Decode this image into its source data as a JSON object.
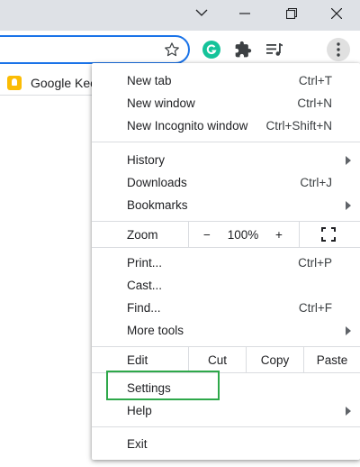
{
  "titlebar": {
    "minimize_glyph": "⌵",
    "restore_glyph": "❐",
    "close_glyph": "✕"
  },
  "toolbar": {
    "star_glyph": "☆",
    "grammarly_glyph": "G",
    "extensions_glyph": "✦",
    "media_glyph": "≡♪",
    "menu_glyph": "⋮"
  },
  "bookmarks": {
    "items": [
      {
        "label": "Google Kee"
      }
    ]
  },
  "menu": {
    "new_tab": {
      "label": "New tab",
      "shortcut": "Ctrl+T"
    },
    "new_window": {
      "label": "New window",
      "shortcut": "Ctrl+N"
    },
    "new_incognito": {
      "label": "New Incognito window",
      "shortcut": "Ctrl+Shift+N"
    },
    "history": {
      "label": "History"
    },
    "downloads": {
      "label": "Downloads",
      "shortcut": "Ctrl+J"
    },
    "bookmarks": {
      "label": "Bookmarks"
    },
    "zoom": {
      "label": "Zoom",
      "minus": "−",
      "level": "100%",
      "plus": "+"
    },
    "print": {
      "label": "Print...",
      "shortcut": "Ctrl+P"
    },
    "cast": {
      "label": "Cast..."
    },
    "find": {
      "label": "Find...",
      "shortcut": "Ctrl+F"
    },
    "more_tools": {
      "label": "More tools"
    },
    "edit": {
      "label": "Edit",
      "cut": "Cut",
      "copy": "Copy",
      "paste": "Paste"
    },
    "settings": {
      "label": "Settings"
    },
    "help": {
      "label": "Help"
    },
    "exit": {
      "label": "Exit"
    }
  },
  "colors": {
    "accent": "#1a73e8",
    "highlight": "#2ea84a",
    "grammarly": "#15c39a"
  }
}
